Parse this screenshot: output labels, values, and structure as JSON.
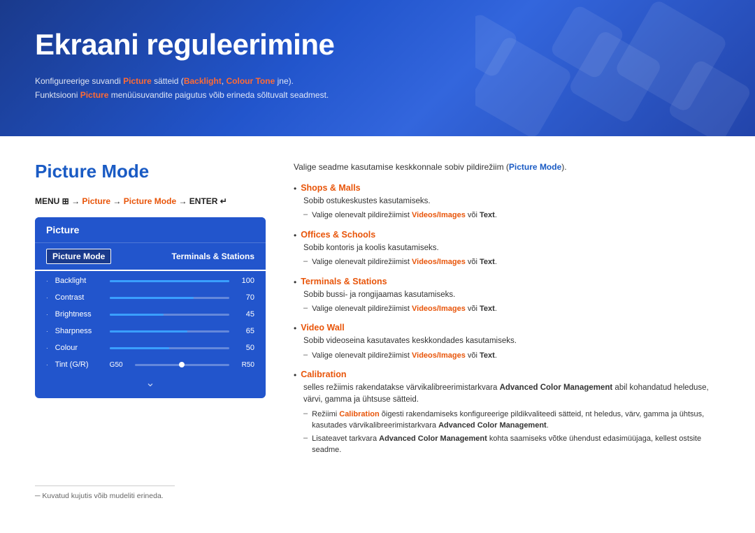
{
  "header": {
    "title": "Ekraani reguleerimine",
    "line1_pre": "Konfigureerige suvandi ",
    "line1_highlight1": "Picture",
    "line1_mid": " sätteid (",
    "line1_highlight2": "Backlight",
    "line1_comma": ", ",
    "line1_highlight3": "Colour Tone",
    "line1_post": " jne).",
    "line2_pre": "Funktsiooni ",
    "line2_highlight": "Picture",
    "line2_post": " menüüsuvandite paigutus võib erineda sõltuvalt seadmest."
  },
  "picture_mode": {
    "section_title": "Picture Mode",
    "menu_path_pre": "MENU ",
    "menu_path_icon": "⊞",
    "menu_path_arrow1": " → ",
    "menu_path_picture": "Picture",
    "menu_path_arrow2": " → ",
    "menu_path_mode": "Picture Mode",
    "menu_path_arrow3": " → ENTER ",
    "menu_path_enter": "↵",
    "box_header": "Picture",
    "mode_label": "Picture Mode",
    "mode_value": "Terminals & Stations",
    "sliders": [
      {
        "label": "Backlight",
        "value": 100,
        "percent": 100
      },
      {
        "label": "Contrast",
        "value": 70,
        "percent": 70
      },
      {
        "label": "Brightness",
        "value": 45,
        "percent": 45
      },
      {
        "label": "Sharpness",
        "value": 65,
        "percent": 65
      },
      {
        "label": "Colour",
        "value": 50,
        "percent": 50
      }
    ],
    "tint_left": "G50",
    "tint_right": "R50",
    "tint_label": "Tint (G/R)"
  },
  "right_panel": {
    "intro": "Valige seadme kasutamise keskkonnale sobiv pildirežiim (",
    "intro_highlight": "Picture Mode",
    "intro_post": ").",
    "items": [
      {
        "title": "Shops & Malls",
        "desc": "Sobib ostukeskustes kasutamiseks.",
        "sub": "Valige olenevalt pildirežiimist ",
        "sub_bold1": "Videos/Images",
        "sub_mid": " või ",
        "sub_bold2": "Text",
        "sub_end": "."
      },
      {
        "title": "Offices & Schools",
        "desc": "Sobib kontoris ja koolis kasutamiseks.",
        "sub": "Valige olenevalt pildirežiimist ",
        "sub_bold1": "Videos/Images",
        "sub_mid": " või ",
        "sub_bold2": "Text",
        "sub_end": "."
      },
      {
        "title": "Terminals & Stations",
        "desc": "Sobib bussi- ja rongijaamas kasutamiseks.",
        "sub": "Valige olenevalt pildirežiimist ",
        "sub_bold1": "Videos/Images",
        "sub_mid": " või ",
        "sub_bold2": "Text",
        "sub_end": "."
      },
      {
        "title": "Video Wall",
        "desc": "Sobib videoseina kasutavates keskkondades kasutamiseks.",
        "sub": "Valige olenevalt pildirežiimist ",
        "sub_bold1": "Videos/Images",
        "sub_mid": " või ",
        "sub_bold2": "Text",
        "sub_end": "."
      },
      {
        "title": "Calibration",
        "desc": "selles režiimis rakendatakse värvikalibreerimistarkvara ",
        "desc_bold": "Advanced Color Management",
        "desc_post": " abil kohandatud heleduse, värvi, gamma ja ühtsuse sätteid.",
        "subs": [
          {
            "text": "Režiimi ",
            "bold1": "Calibration",
            "mid1": " õigesti rakendamiseks konfigureerige pildikvaliteedi sätteid, nt heledus, värv, gamma ja ühtsus, kasutades värvikalibreerimistarkvara ",
            "bold2": "Advanced Color Management",
            "end": "."
          },
          {
            "text": "Lisateavet tarkvara ",
            "bold1": "Advanced Color Management",
            "mid1": " kohta saamiseks võtke ühendust edasimüüjaga, kellest ostsite seadme."
          }
        ]
      }
    ]
  },
  "footer": {
    "note": "Kuvatud kujutis võib mudeliti erineda."
  }
}
